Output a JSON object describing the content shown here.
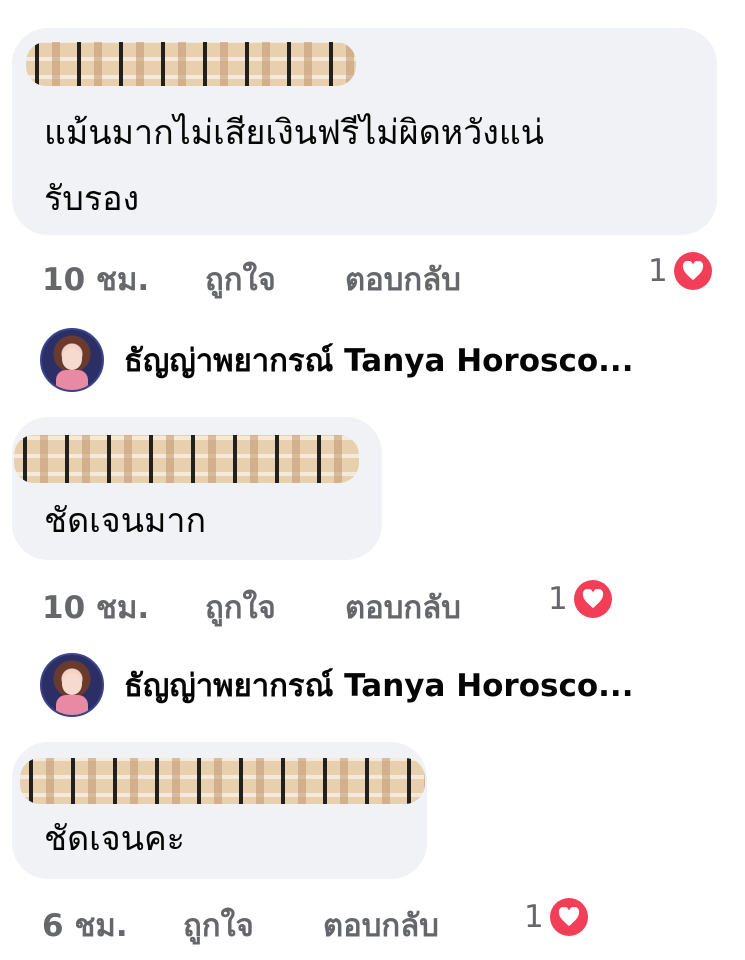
{
  "comments": [
    {
      "text": "แม้นมากไม่เสียเงินฟรีไม่ผิดหวังแน่\nรับรอง",
      "time": "10 ชม.",
      "like_label": "ถูกใจ",
      "reply_label": "ตอบกลับ",
      "reaction_count": "1"
    },
    {
      "text": "ชัดเจนมาก",
      "time": "10 ชม.",
      "like_label": "ถูกใจ",
      "reply_label": "ตอบกลับ",
      "reaction_count": "1"
    },
    {
      "text": "ชัดเจนคะ",
      "time": "6 ชม.",
      "like_label": "ถูกใจ",
      "reply_label": "ตอบกลับ",
      "reaction_count": "1"
    }
  ],
  "replies": [
    {
      "author": "ธัญญ่าพยากรณ์ Tanya Horosco..."
    },
    {
      "author": "ธัญญ่าพยากรณ์ Tanya Horosco..."
    }
  ],
  "colors": {
    "bubble": "#f0f2f5",
    "meta_text": "#65676b",
    "heart": "#f33e58"
  },
  "icons": {
    "reaction": "heart-icon"
  }
}
